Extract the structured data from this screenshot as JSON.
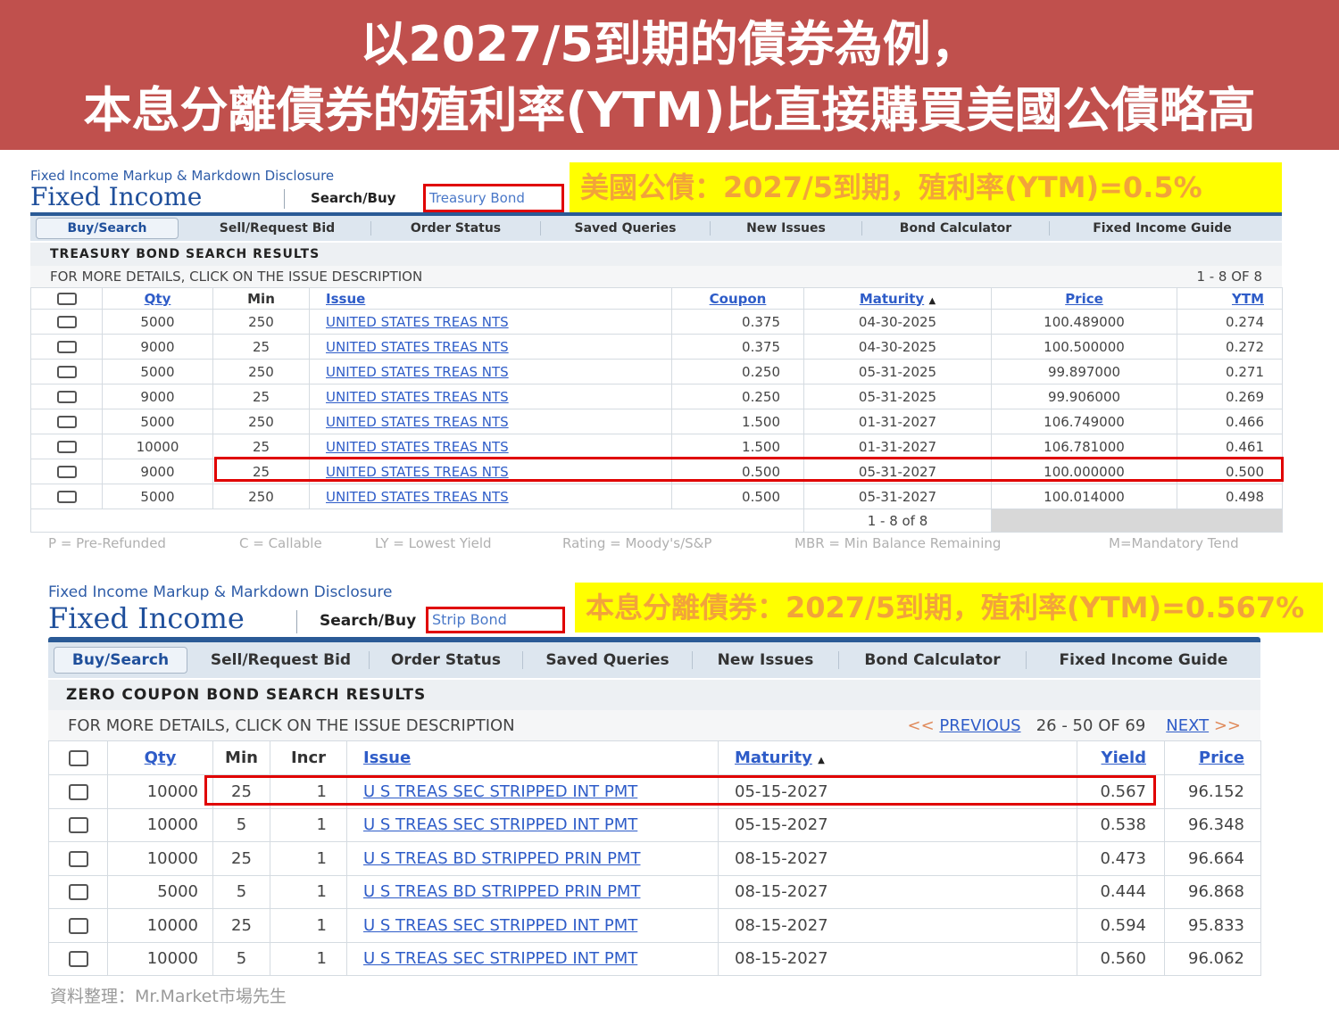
{
  "banner": {
    "line1": "以2027/5到期的債券為例，",
    "line2": "本息分離債券的殖利率(YTM)比直接購買美國公債略高"
  },
  "panel1": {
    "disclosure": "Fixed Income Markup & Markdown Disclosure",
    "brand": "Fixed Income",
    "search_buy": "Search/Buy",
    "search_type": "Treasury Bond",
    "highlight": "美國公債：2027/5到期，殖利率(YTM)=0.5%",
    "nav": [
      "Buy/Search",
      "Sell/Request Bid",
      "Order Status",
      "Saved Queries",
      "New Issues",
      "Bond Calculator",
      "Fixed Income Guide"
    ],
    "results_title": "TREASURY BOND SEARCH RESULTS",
    "details_text": "FOR MORE DETAILS, CLICK ON THE ISSUE DESCRIPTION",
    "range": "1 - 8 OF 8",
    "columns": [
      "Qty",
      "Min",
      "Issue",
      "Coupon",
      "Maturity",
      "Price",
      "YTM"
    ],
    "rows": [
      [
        "5000",
        "250",
        "UNITED STATES TREAS NTS",
        "0.375",
        "04-30-2025",
        "100.489000",
        "0.274"
      ],
      [
        "9000",
        "25",
        "UNITED STATES TREAS NTS",
        "0.375",
        "04-30-2025",
        "100.500000",
        "0.272"
      ],
      [
        "5000",
        "250",
        "UNITED STATES TREAS NTS",
        "0.250",
        "05-31-2025",
        "99.897000",
        "0.271"
      ],
      [
        "9000",
        "25",
        "UNITED STATES TREAS NTS",
        "0.250",
        "05-31-2025",
        "99.906000",
        "0.269"
      ],
      [
        "5000",
        "250",
        "UNITED STATES TREAS NTS",
        "1.500",
        "01-31-2027",
        "106.749000",
        "0.466"
      ],
      [
        "10000",
        "25",
        "UNITED STATES TREAS NTS",
        "1.500",
        "01-31-2027",
        "106.781000",
        "0.461"
      ],
      [
        "9000",
        "25",
        "UNITED STATES TREAS NTS",
        "0.500",
        "05-31-2027",
        "100.000000",
        "0.500"
      ],
      [
        "5000",
        "250",
        "UNITED STATES TREAS NTS",
        "0.500",
        "05-31-2027",
        "100.014000",
        "0.498"
      ]
    ],
    "footer_range": "1 - 8 of 8",
    "legend": [
      "P = Pre-Refunded",
      "C = Callable",
      "LY = Lowest Yield",
      "Rating = Moody's/S&P",
      "MBR = Min Balance Remaining",
      "M=Mandatory Tend"
    ]
  },
  "panel2": {
    "disclosure": "Fixed Income Markup & Markdown Disclosure",
    "brand": "Fixed Income",
    "search_buy": "Search/Buy",
    "search_type": "Strip Bond",
    "highlight": "本息分離債券：2027/5到期，殖利率(YTM)=0.567%",
    "nav": [
      "Buy/Search",
      "Sell/Request Bid",
      "Order Status",
      "Saved Queries",
      "New Issues",
      "Bond Calculator",
      "Fixed Income Guide"
    ],
    "results_title": "ZERO COUPON BOND SEARCH RESULTS",
    "details_text": "FOR MORE DETAILS, CLICK ON THE ISSUE DESCRIPTION",
    "prev_arrows": "<<",
    "prev": "PREVIOUS",
    "range": "26 - 50 OF 69",
    "next": "NEXT",
    "next_arrows": ">>",
    "columns": [
      "Qty",
      "Min",
      "Incr",
      "Issue",
      "Maturity",
      "Yield",
      "Price"
    ],
    "rows": [
      [
        "10000",
        "25",
        "1",
        "U S TREAS SEC STRIPPED INT PMT",
        "05-15-2027",
        "0.567",
        "96.152"
      ],
      [
        "10000",
        "5",
        "1",
        "U S TREAS SEC STRIPPED INT PMT",
        "05-15-2027",
        "0.538",
        "96.348"
      ],
      [
        "10000",
        "25",
        "1",
        "U S TREAS BD STRIPPED PRIN PMT",
        "08-15-2027",
        "0.473",
        "96.664"
      ],
      [
        "5000",
        "5",
        "1",
        "U S TREAS BD STRIPPED PRIN PMT",
        "08-15-2027",
        "0.444",
        "96.868"
      ],
      [
        "10000",
        "25",
        "1",
        "U S TREAS SEC STRIPPED INT PMT",
        "08-15-2027",
        "0.594",
        "95.833"
      ],
      [
        "10000",
        "5",
        "1",
        "U S TREAS SEC STRIPPED INT PMT",
        "08-15-2027",
        "0.560",
        "96.062"
      ]
    ]
  },
  "source": "資料整理：Mr.Market市場先生"
}
